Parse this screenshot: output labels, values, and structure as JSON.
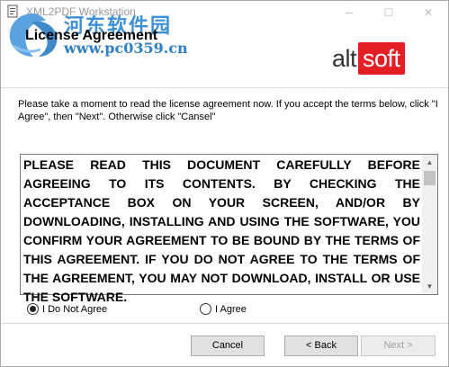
{
  "window": {
    "title": "XML2PDF Workstation",
    "minimize_glyph": "─",
    "maximize_glyph": "☐",
    "close_glyph": "✕"
  },
  "watermark": {
    "site_name": "河东软件园",
    "url": "www.pc0359.cn"
  },
  "header": {
    "title": "License Agreement",
    "brand_alt": "alt",
    "brand_soft": "soft",
    "brand_color": "#e31e24"
  },
  "instructions": "Please take a moment to read the license agreement now. If you accept the terms below, click \"I Agree\", then \"Next\". Otherwise click \"Cansel\"",
  "license": {
    "text": "PLEASE READ THIS DOCUMENT CAREFULLY BEFORE AGREEING TO ITS CONTENTS. BY CHECKING THE ACCEPTANCE BOX ON YOUR SCREEN, AND/OR BY DOWNLOADING, INSTALLING AND USING THE SOFTWARE, YOU CONFIRM YOUR AGREEMENT TO BE BOUND BY THE TERMS OF THIS AGREEMENT. IF YOU DO NOT AGREE TO THE TERMS OF THE AGREEMENT, YOU MAY NOT DOWNLOAD, INSTALL OR USE THE SOFTWARE."
  },
  "options": {
    "disagree_label": "I Do Not Agree",
    "agree_label": "I Agree",
    "selected": "disagree"
  },
  "buttons": {
    "cancel": "Cancel",
    "back": "< Back",
    "next": "Next >"
  }
}
